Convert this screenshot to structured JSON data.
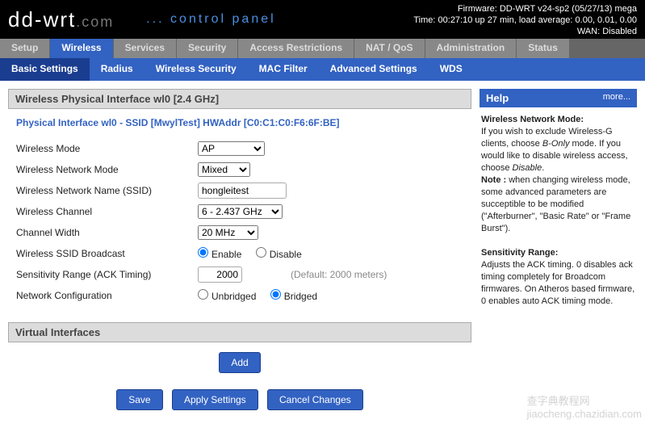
{
  "header": {
    "logo_main": "dd-wrt",
    "logo_dom": ".com",
    "cpanel": "... control panel",
    "firmware": "Firmware: DD-WRT v24-sp2 (05/27/13) mega",
    "time": "Time: 00:27:10 up 27 min, load average: 0.00, 0.01, 0.00",
    "wan": "WAN: Disabled"
  },
  "tabs": {
    "main": [
      "Setup",
      "Wireless",
      "Services",
      "Security",
      "Access Restrictions",
      "NAT / QoS",
      "Administration",
      "Status"
    ],
    "sub": [
      "Basic Settings",
      "Radius",
      "Wireless Security",
      "MAC Filter",
      "Advanced Settings",
      "WDS"
    ]
  },
  "section": {
    "heading": "Wireless Physical Interface wl0 [2.4 GHz]",
    "fieldset_title": "Physical Interface wl0 - SSID [MwylTest] HWAddr [C0:C1:C0:F6:6F:BE]"
  },
  "form": {
    "mode_label": "Wireless Mode",
    "mode_value": "AP",
    "netmode_label": "Wireless Network Mode",
    "netmode_value": "Mixed",
    "ssid_label": "Wireless Network Name (SSID)",
    "ssid_value": "hongleitest",
    "channel_label": "Wireless Channel",
    "channel_value": "6 - 2.437 GHz",
    "width_label": "Channel Width",
    "width_value": "20 MHz",
    "broadcast_label": "Wireless SSID Broadcast",
    "enable": "Enable",
    "disable": "Disable",
    "sens_label": "Sensitivity Range (ACK Timing)",
    "sens_value": "2000",
    "sens_default": "(Default: 2000 meters)",
    "netcfg_label": "Network Configuration",
    "unbridged": "Unbridged",
    "bridged": "Bridged"
  },
  "virtual": {
    "heading": "Virtual Interfaces",
    "add": "Add"
  },
  "actions": {
    "save": "Save",
    "apply": "Apply Settings",
    "cancel": "Cancel Changes"
  },
  "help": {
    "heading": "Help",
    "more": "more...",
    "h1": "Wireless Network Mode:",
    "p1a": "If you wish to exclude Wireless-G clients, choose ",
    "p1b": "B-Only",
    "p1c": " mode. If you would like to disable wireless access, choose ",
    "p1d": "Disable",
    "p1e": ".",
    "note_lbl": "Note :",
    "note_txt": " when changing wireless mode, some advanced parameters are succeptible to be modified (\"Afterburner\", \"Basic Rate\" or \"Frame Burst\").",
    "h2": "Sensitivity Range:",
    "p2": "Adjusts the ACK timing. 0 disables ack timing completely for Broadcom firmwares. On Atheros based firmware, 0 enables auto ACK timing mode."
  },
  "watermark": "查字典教程网\njiaocheng.chazidian.com"
}
